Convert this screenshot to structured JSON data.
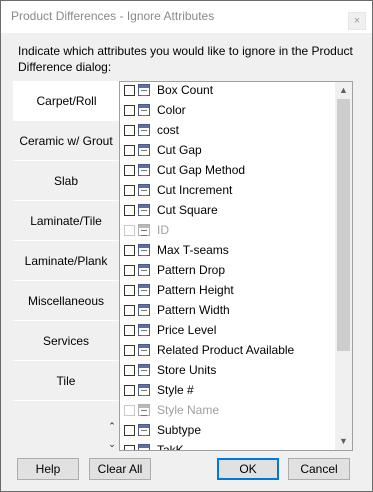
{
  "window": {
    "title": "Product Differences - Ignore Attributes",
    "close_glyph": "×"
  },
  "instruction": "Indicate which attributes you would like to ignore in the Product Difference dialog:",
  "tabs": [
    {
      "label": "Carpet/Roll",
      "active": true
    },
    {
      "label": "Ceramic w/ Grout",
      "active": false
    },
    {
      "label": "Slab",
      "active": false
    },
    {
      "label": "Laminate/Tile",
      "active": false
    },
    {
      "label": "Laminate/Plank",
      "active": false
    },
    {
      "label": "Miscellaneous",
      "active": false
    },
    {
      "label": "Services",
      "active": false
    },
    {
      "label": "Tile",
      "active": false
    }
  ],
  "tab_scroll": {
    "up": "⌃",
    "down": "⌄"
  },
  "attributes": [
    {
      "label": "Box Count",
      "checked": false,
      "enabled": true
    },
    {
      "label": "Color",
      "checked": false,
      "enabled": true
    },
    {
      "label": "cost",
      "checked": false,
      "enabled": true
    },
    {
      "label": "Cut Gap",
      "checked": false,
      "enabled": true
    },
    {
      "label": "Cut Gap Method",
      "checked": false,
      "enabled": true
    },
    {
      "label": "Cut Increment",
      "checked": false,
      "enabled": true
    },
    {
      "label": "Cut Square",
      "checked": false,
      "enabled": true
    },
    {
      "label": "ID",
      "checked": false,
      "enabled": false
    },
    {
      "label": "Max T-seams",
      "checked": false,
      "enabled": true
    },
    {
      "label": "Pattern Drop",
      "checked": false,
      "enabled": true
    },
    {
      "label": "Pattern Height",
      "checked": false,
      "enabled": true
    },
    {
      "label": "Pattern Width",
      "checked": false,
      "enabled": true
    },
    {
      "label": "Price Level",
      "checked": false,
      "enabled": true
    },
    {
      "label": "Related Product Available",
      "checked": false,
      "enabled": true
    },
    {
      "label": "Store Units",
      "checked": false,
      "enabled": true
    },
    {
      "label": "Style #",
      "checked": false,
      "enabled": true
    },
    {
      "label": "Style Name",
      "checked": false,
      "enabled": false
    },
    {
      "label": "Subtype",
      "checked": false,
      "enabled": true
    },
    {
      "label": "TakK",
      "checked": false,
      "enabled": true
    }
  ],
  "list_scroll": {
    "up": "▲",
    "down": "▼"
  },
  "buttons": {
    "help": "Help",
    "clear_all": "Clear All",
    "ok": "OK",
    "cancel": "Cancel"
  }
}
